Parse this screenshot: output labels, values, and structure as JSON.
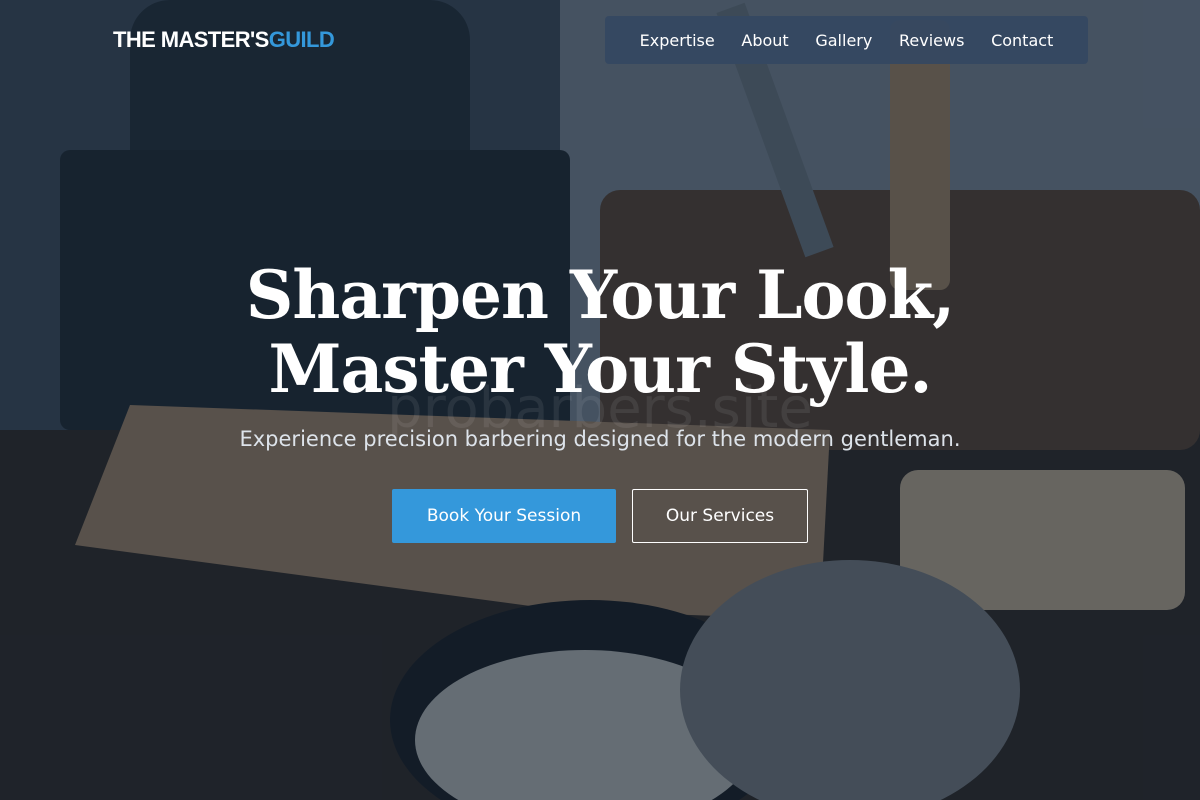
{
  "brand": {
    "name_main": "THE MASTER'S",
    "name_accent": "GUILD"
  },
  "nav": {
    "items": [
      "Expertise",
      "About",
      "Gallery",
      "Reviews",
      "Contact"
    ]
  },
  "hero": {
    "headline_line1": "Sharpen Your Look,",
    "headline_line2": "Master Your Style.",
    "watermark": "probarbers.site",
    "subtext": "Experience precision barbering designed for the modern gentleman.",
    "primary_cta": "Book Your Session",
    "secondary_cta": "Our Services"
  },
  "colors": {
    "accent": "#3498db",
    "nav_bg": "#344862",
    "overlay": "#162232"
  }
}
